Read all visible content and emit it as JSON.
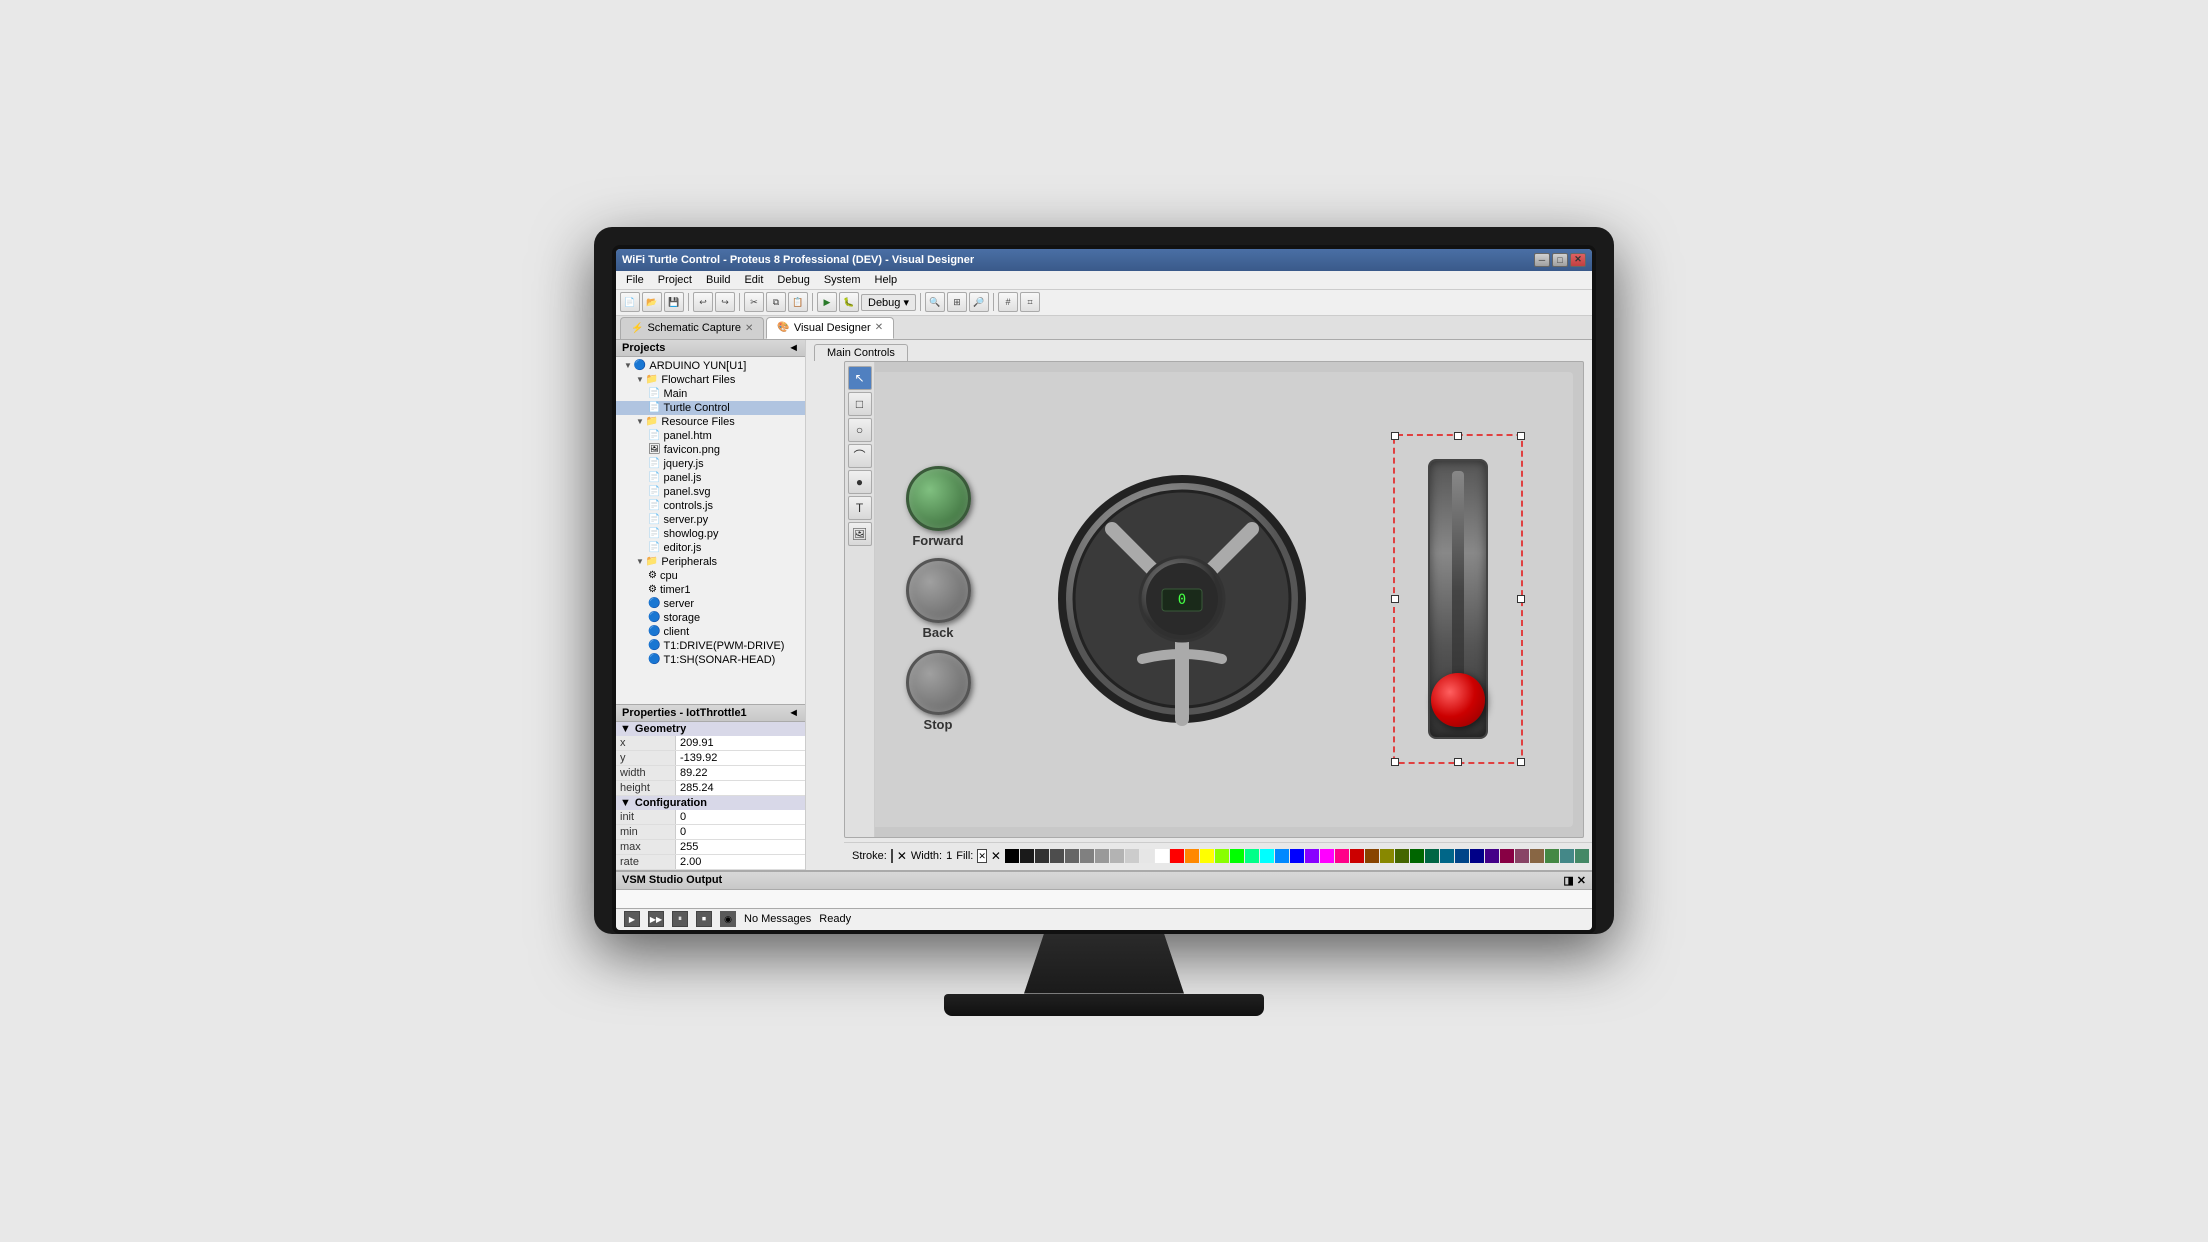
{
  "window": {
    "title": "WiFi Turtle Control - Proteus 8 Professional (DEV) - Visual Designer",
    "min_label": "─",
    "max_label": "□",
    "close_label": "✕"
  },
  "menu": {
    "items": [
      "File",
      "Project",
      "Build",
      "Edit",
      "Debug",
      "System",
      "Help"
    ]
  },
  "tabs": {
    "schematic": "Schematic Capture",
    "visual": "Visual Designer"
  },
  "projects_panel": {
    "title": "Projects",
    "collapse_icon": "◄",
    "tree": [
      {
        "label": "ARDUINO YUN[U1]",
        "depth": 1,
        "type": "root",
        "arrow": "▼"
      },
      {
        "label": "Flowchart Files",
        "depth": 2,
        "type": "folder",
        "arrow": "▼"
      },
      {
        "label": "Main",
        "depth": 3,
        "type": "file"
      },
      {
        "label": "Turtle Control",
        "depth": 3,
        "type": "file",
        "selected": true
      },
      {
        "label": "Resource Files",
        "depth": 2,
        "type": "folder",
        "arrow": "▼"
      },
      {
        "label": "panel.htm",
        "depth": 3,
        "type": "file"
      },
      {
        "label": "favicon.png",
        "depth": 3,
        "type": "file"
      },
      {
        "label": "jquery.js",
        "depth": 3,
        "type": "file"
      },
      {
        "label": "panel.js",
        "depth": 3,
        "type": "file"
      },
      {
        "label": "panel.svg",
        "depth": 3,
        "type": "file"
      },
      {
        "label": "controls.js",
        "depth": 3,
        "type": "file"
      },
      {
        "label": "server.py",
        "depth": 3,
        "type": "file"
      },
      {
        "label": "showlog.py",
        "depth": 3,
        "type": "file"
      },
      {
        "label": "editor.js",
        "depth": 3,
        "type": "file"
      },
      {
        "label": "Peripherals",
        "depth": 2,
        "type": "folder",
        "arrow": "▼"
      },
      {
        "label": "cpu",
        "depth": 3,
        "type": "peripheral"
      },
      {
        "label": "timer1",
        "depth": 3,
        "type": "peripheral"
      },
      {
        "label": "server",
        "depth": 3,
        "type": "peripheral"
      },
      {
        "label": "storage",
        "depth": 3,
        "type": "peripheral"
      },
      {
        "label": "client",
        "depth": 3,
        "type": "peripheral"
      },
      {
        "label": "T1:DRIVE(PWM-DRIVE)",
        "depth": 3,
        "type": "peripheral"
      },
      {
        "label": "T1:SH(SONAR-HEAD)",
        "depth": 3,
        "type": "peripheral"
      }
    ]
  },
  "properties_panel": {
    "title": "Properties - IotThrottle1",
    "sections": {
      "geometry": {
        "label": "Geometry",
        "fields": [
          {
            "label": "x",
            "value": "209.91"
          },
          {
            "label": "y",
            "value": "-139.92"
          },
          {
            "label": "width",
            "value": "89.22"
          },
          {
            "label": "height",
            "value": "285.24"
          }
        ]
      },
      "configuration": {
        "label": "Configuration",
        "fields": [
          {
            "label": "init",
            "value": "0"
          },
          {
            "label": "min",
            "value": "0"
          },
          {
            "label": "max",
            "value": "255"
          },
          {
            "label": "rate",
            "value": "2.00"
          }
        ]
      }
    }
  },
  "main_controls": {
    "tab_label": "Main Controls",
    "buttons": {
      "forward": "Forward",
      "back": "Back",
      "stop": "Stop"
    },
    "steering_value": "0"
  },
  "left_toolbar": {
    "tools": [
      "↖",
      "□",
      "○",
      "⌒",
      "●",
      "T",
      "🖼"
    ]
  },
  "color_bar": {
    "stroke_label": "Stroke:",
    "width_label": "Width:",
    "width_value": "1",
    "fill_label": "Fill:"
  },
  "colors": [
    "#000000",
    "#1a1a1a",
    "#333333",
    "#4d4d4d",
    "#666666",
    "#808080",
    "#999999",
    "#b3b3b3",
    "#cccccc",
    "#e6e6e6",
    "#ffffff",
    "#ff0000",
    "#ff8800",
    "#ffff00",
    "#88ff00",
    "#00ff00",
    "#00ff88",
    "#00ffff",
    "#0088ff",
    "#0000ff",
    "#8800ff",
    "#ff00ff",
    "#ff0088",
    "#cc0000",
    "#884400",
    "#888800",
    "#446600",
    "#006600",
    "#006644",
    "#006688",
    "#004488",
    "#000088",
    "#440088",
    "#880044",
    "#884466",
    "#886644",
    "#448844",
    "#448888",
    "#448866"
  ],
  "vsm_output": {
    "title": "VSM Studio Output",
    "controls": "◨ ✕"
  },
  "status_bar": {
    "messages": "No Messages",
    "ready": "Ready"
  }
}
